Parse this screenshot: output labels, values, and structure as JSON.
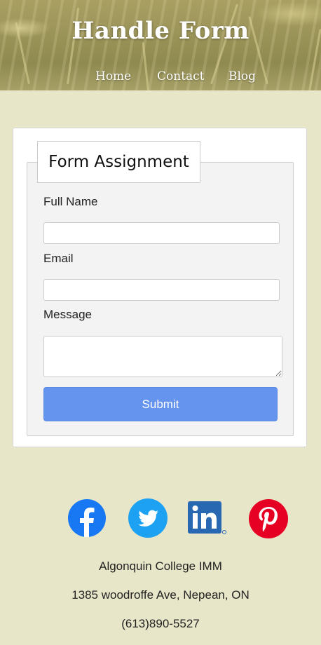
{
  "header": {
    "title": "Handle Form",
    "nav": [
      {
        "label": "Home"
      },
      {
        "label": "Contact"
      },
      {
        "label": "Blog"
      }
    ]
  },
  "form": {
    "legend": "Form Assignment",
    "fields": {
      "full_name": {
        "label": "Full Name",
        "value": ""
      },
      "email": {
        "label": "Email",
        "value": ""
      },
      "message": {
        "label": "Message",
        "value": ""
      }
    },
    "submit_label": "Submit"
  },
  "social": [
    {
      "icon": "facebook-icon",
      "color": "#1877f2"
    },
    {
      "icon": "twitter-icon",
      "color": "#1da1f2"
    },
    {
      "icon": "linkedin-icon",
      "color": "#2867b2"
    },
    {
      "icon": "pinterest-icon",
      "color": "#e60023"
    }
  ],
  "footer": {
    "org": "Algonquin College IMM",
    "address": "1385 woodroffe Ave, Nepean, ON",
    "phone": "(613)890-5527"
  },
  "colors": {
    "page_bg": "#e8e6c9",
    "submit_bg": "#6594ee"
  }
}
